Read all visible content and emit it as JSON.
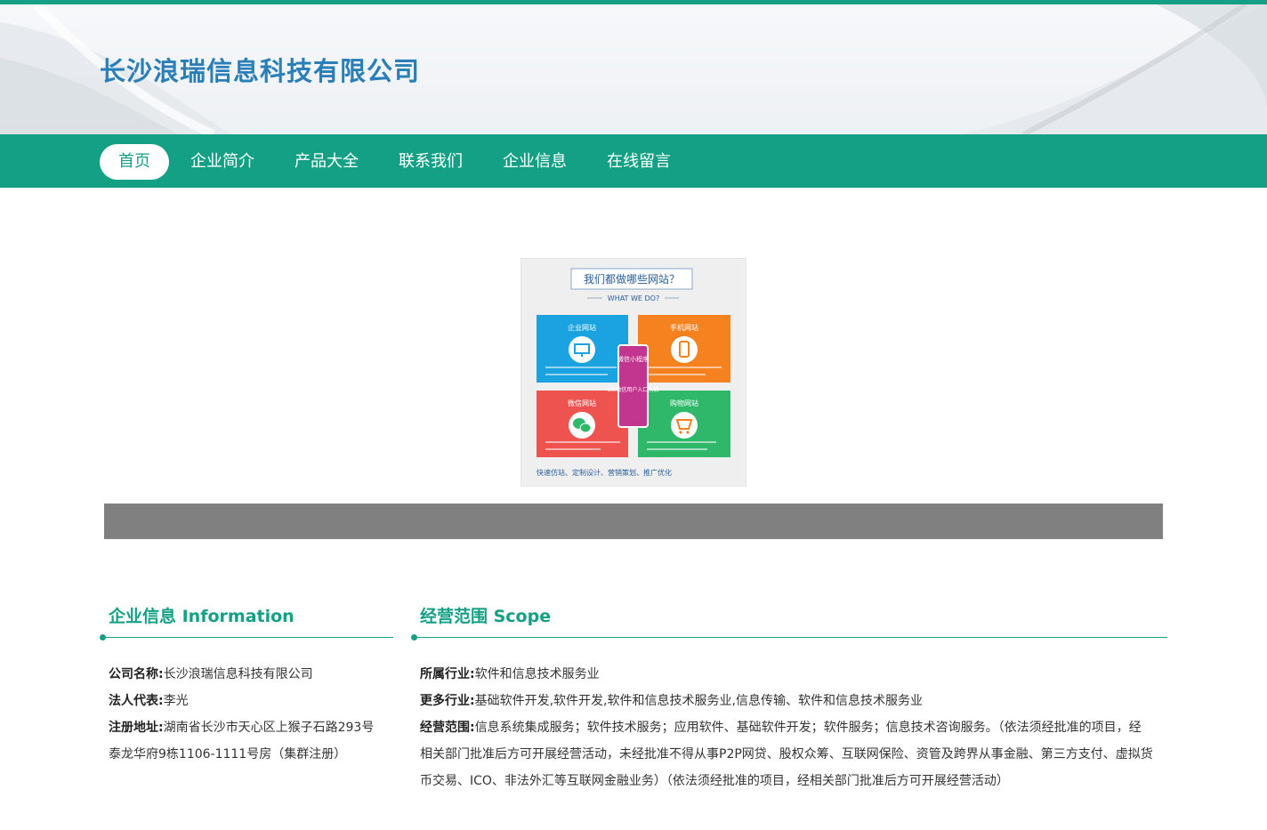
{
  "header": {
    "company_title": "长沙浪瑞信息科技有限公司"
  },
  "nav": {
    "items": [
      "首页",
      "企业简介",
      "产品大全",
      "联系我们",
      "企业信息",
      "在线留言"
    ],
    "active_index": 0
  },
  "promo": {
    "heading": "我们都做哪些网站？",
    "subheading": "WHAT WE DO?",
    "tiles": {
      "enterprise": "企业网站",
      "mobile": "手机网站",
      "wechat": "微信网站",
      "shop": "购物网站"
    },
    "center_top": "微信小程序",
    "center_bottom": "8亿微信用户入口引流",
    "footer": "快速仿站、定制设计、营销策划、推广优化",
    "colors": {
      "enterprise": "#1aa3e0",
      "mobile": "#f5821f",
      "wechat": "#ef5350",
      "shop": "#2fb86a",
      "center": "#c2368f"
    }
  },
  "info_section": {
    "title": "企业信息 Information",
    "company_label": "公司名称:",
    "company_value": "长沙浪瑞信息科技有限公司",
    "legal_label": "法人代表:",
    "legal_value": "李光",
    "address_label": "注册地址:",
    "address_line1": "湖南省长沙市天心区上猴子石路293号",
    "address_line2": "泰龙华府9栋1106-1111号房（集群注册）"
  },
  "scope_section": {
    "title": "经营范围 Scope",
    "industry_label": "所属行业:",
    "industry_value": "软件和信息技术服务业",
    "more_label": "更多行业:",
    "more_value": "基础软件开发,软件开发,软件和信息技术服务业,信息传输、软件和信息技术服务业",
    "scope_label": "经营范围:",
    "scope_line1": "信息系统集成服务；软件技术服务；应用软件、基础软件开发；软件服务；信息技术咨询服务。（依法须经批准的项目，经",
    "scope_line2": "相关部门批准后方可开展经营活动，未经批准不得从事P2P网贷、股权众筹、互联网保险、资管及跨界从事金融、第三方支付、虚拟货",
    "scope_line3": "币交易、ICO、非法外汇等互联网金融业务）（依法须经批准的项目，经相关部门批准后方可开展经营活动）"
  },
  "theme": {
    "primary": "#14a085",
    "title_blue": "#2b7fb8",
    "gray_bar": "#808080"
  }
}
